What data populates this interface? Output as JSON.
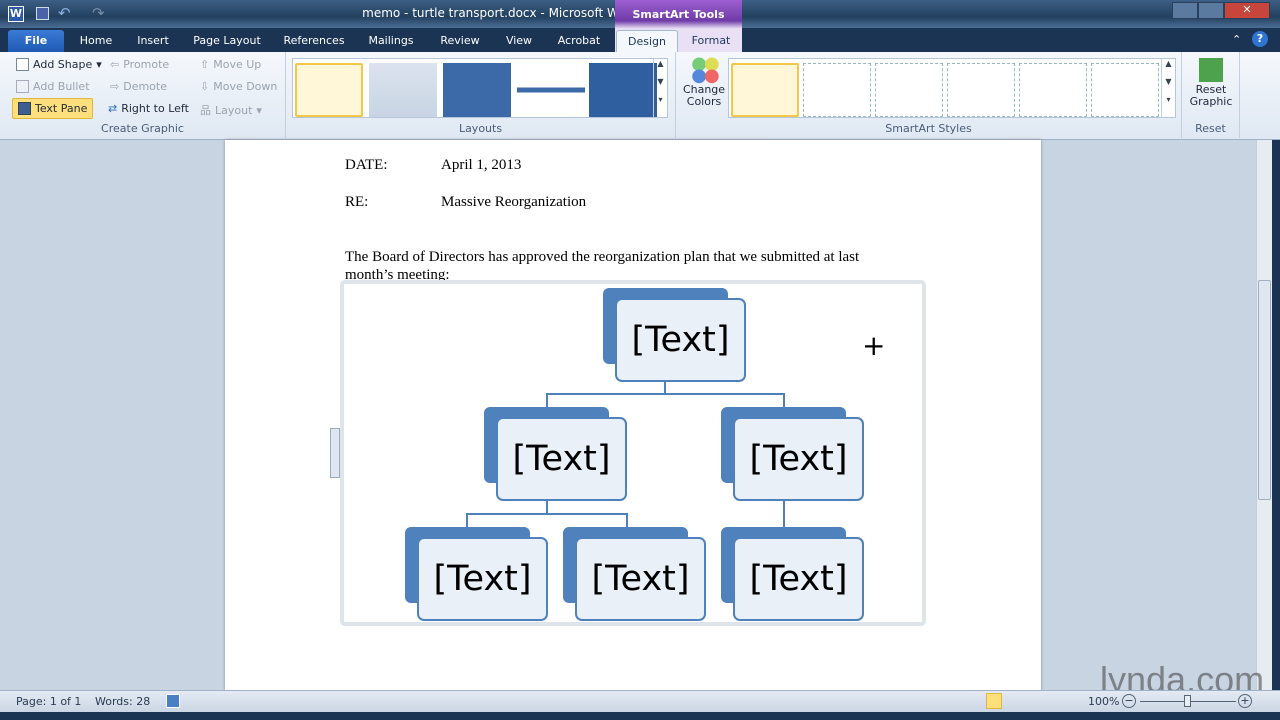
{
  "window": {
    "title": "memo - turtle transport.docx - Microsoft Word",
    "context_tab_group": "SmartArt Tools"
  },
  "tabs": [
    {
      "label": "File"
    },
    {
      "label": "Home"
    },
    {
      "label": "Insert"
    },
    {
      "label": "Page Layout"
    },
    {
      "label": "References"
    },
    {
      "label": "Mailings"
    },
    {
      "label": "Review"
    },
    {
      "label": "View"
    },
    {
      "label": "Acrobat"
    },
    {
      "label": "Design",
      "active": true
    },
    {
      "label": "Format"
    }
  ],
  "ribbon": {
    "create_graphic": {
      "label": "Create Graphic",
      "add_shape": "Add Shape",
      "add_bullet": "Add Bullet",
      "text_pane": "Text Pane",
      "promote": "Promote",
      "demote": "Demote",
      "right_to_left": "Right to Left",
      "move_up": "Move Up",
      "move_down": "Move Down",
      "layout": "Layout"
    },
    "layouts": {
      "label": "Layouts"
    },
    "change_colors": "Change Colors",
    "smartart_styles": {
      "label": "SmartArt Styles"
    },
    "reset": {
      "label": "Reset",
      "reset_graphic": "Reset Graphic"
    }
  },
  "document": {
    "date_label": "DATE:",
    "date_value": "April 1, 2013",
    "re_label": "RE:",
    "re_value": "Massive Reorganization",
    "para_line1": "The Board of Directors has approved the reorganization plan that we submitted at last",
    "para_line2": "month’s meeting:",
    "smartart": {
      "nodes": [
        "[Text]",
        "[Text]",
        "[Text]",
        "[Text]",
        "[Text]",
        "[Text]"
      ],
      "color": "#4f81bd"
    }
  },
  "status": {
    "page": "Page: 1 of 1",
    "words": "Words: 28",
    "zoom": "100%"
  },
  "watermark": "lynda.com"
}
